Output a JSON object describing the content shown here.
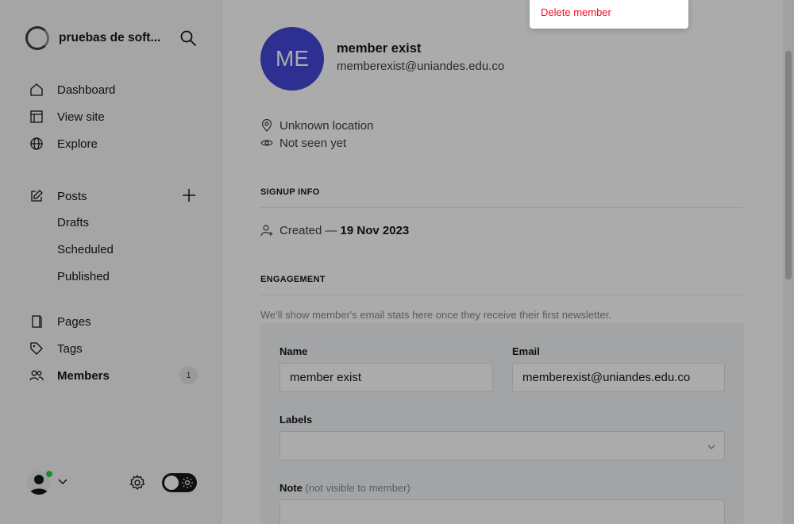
{
  "sidebar": {
    "brand": {
      "name": "pruebas de soft..."
    },
    "nav": {
      "dashboard": "Dashboard",
      "view_site": "View site",
      "explore": "Explore",
      "posts": "Posts",
      "drafts": "Drafts",
      "scheduled": "Scheduled",
      "published": "Published",
      "pages": "Pages",
      "tags": "Tags",
      "members": "Members",
      "members_count": "1"
    }
  },
  "member": {
    "initials": "ME",
    "name": "member exist",
    "email": "memberexist@uniandes.edu.co",
    "location": "Unknown location",
    "last_seen": "Not seen yet",
    "avatar_color": "#4446d9"
  },
  "signup_info": {
    "title": "SIGNUP INFO",
    "created_label": "Created —",
    "created_date": "19 Nov 2023"
  },
  "engagement": {
    "title": "ENGAGEMENT",
    "note": "We'll show member's email stats here once they receive their first newsletter."
  },
  "form": {
    "name_label": "Name",
    "name_value": "member exist",
    "email_label": "Email",
    "email_value": "memberexist@uniandes.edu.co",
    "labels_label": "Labels",
    "note_label": "Note",
    "note_hint": "(not visible to member)"
  },
  "dropdown": {
    "delete_label": "Delete member",
    "delete_color": "#f50b23"
  }
}
